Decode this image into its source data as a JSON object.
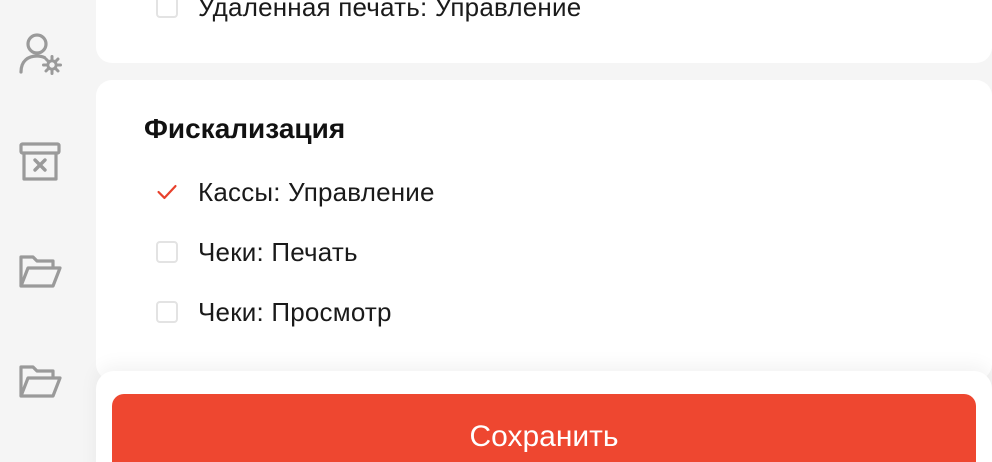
{
  "sidebar": {
    "icons": [
      {
        "name": "user-settings-icon"
      },
      {
        "name": "archive-delete-icon"
      },
      {
        "name": "folder-open-icon"
      },
      {
        "name": "folder-open-icon"
      }
    ]
  },
  "top_card": {
    "items": [
      {
        "label": "Удаленная печать: Управление",
        "checked": false
      }
    ]
  },
  "fiscal_card": {
    "title": "Фискализация",
    "items": [
      {
        "label": "Кассы: Управление",
        "checked": true
      },
      {
        "label": "Чеки: Печать",
        "checked": false
      },
      {
        "label": "Чеки: Просмотр",
        "checked": false
      }
    ]
  },
  "footer": {
    "save_label": "Сохранить"
  },
  "colors": {
    "accent": "#ee4730",
    "check": "#e8412c",
    "icon": "#9a9a9a",
    "checkbox_border": "#e3e3e3"
  }
}
